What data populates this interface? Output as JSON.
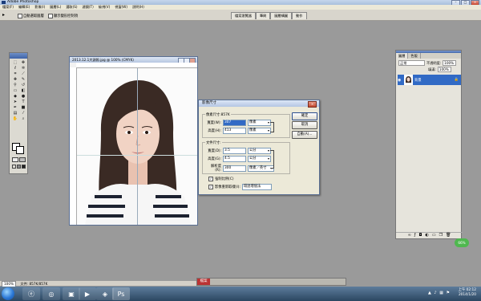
{
  "app": {
    "title": "Adobe Photoshop"
  },
  "menu": [
    "檔案(F)",
    "編輯(E)",
    "影像(I)",
    "圖層(L)",
    "選取(S)",
    "濾鏡(T)",
    "檢視(V)",
    "視窗(W)",
    "說明(H)"
  ],
  "options": {
    "tool": "▸",
    "auto_select": "自動選取圖層",
    "show_transform": "顯示變形控制項"
  },
  "workspace_tabs": [
    "檔案瀏覽器",
    "筆刷",
    "圖層構圖",
    "動作"
  ],
  "document": {
    "title": "2013.12.1大頭照.jpg @ 100% (CMYK)"
  },
  "dialog": {
    "title": "影像尺寸",
    "pixel_group": "像素尺寸:857K",
    "pixel_width_label": "寬度(W):",
    "pixel_width_value": "307",
    "pixel_width_unit": "像素",
    "pixel_height_label": "高度(H):",
    "pixel_height_value": "413",
    "pixel_height_unit": "像素",
    "doc_group": "文件尺寸:",
    "doc_width_label": "寬度(D):",
    "doc_width_value": "3.5",
    "doc_width_unit": "公分",
    "doc_height_label": "高度(G):",
    "doc_height_value": "4.5",
    "doc_height_unit": "公分",
    "res_label": "解析度(R):",
    "res_value": "300",
    "res_unit": "像素／英寸",
    "ok": "確定",
    "cancel": "取消",
    "auto": "自動(A)...",
    "constrain": "強制比例(C)",
    "resample": "影像重新取樣(I):",
    "resample_method": "環迴增值法"
  },
  "panel": {
    "tabs": [
      "圖層",
      "色版"
    ],
    "blend": "正常",
    "opacity_label": "不透明度:",
    "opacity": "100%",
    "fill_label": "填滿:",
    "fill": "100%",
    "layer_name": "背景"
  },
  "status": {
    "zoom": "100%",
    "doc": "文件: 857K/857K"
  },
  "tray_label": "檔案",
  "bubble": "66%",
  "clock": {
    "time": "上午 02:12",
    "date": "2014/1/20"
  }
}
